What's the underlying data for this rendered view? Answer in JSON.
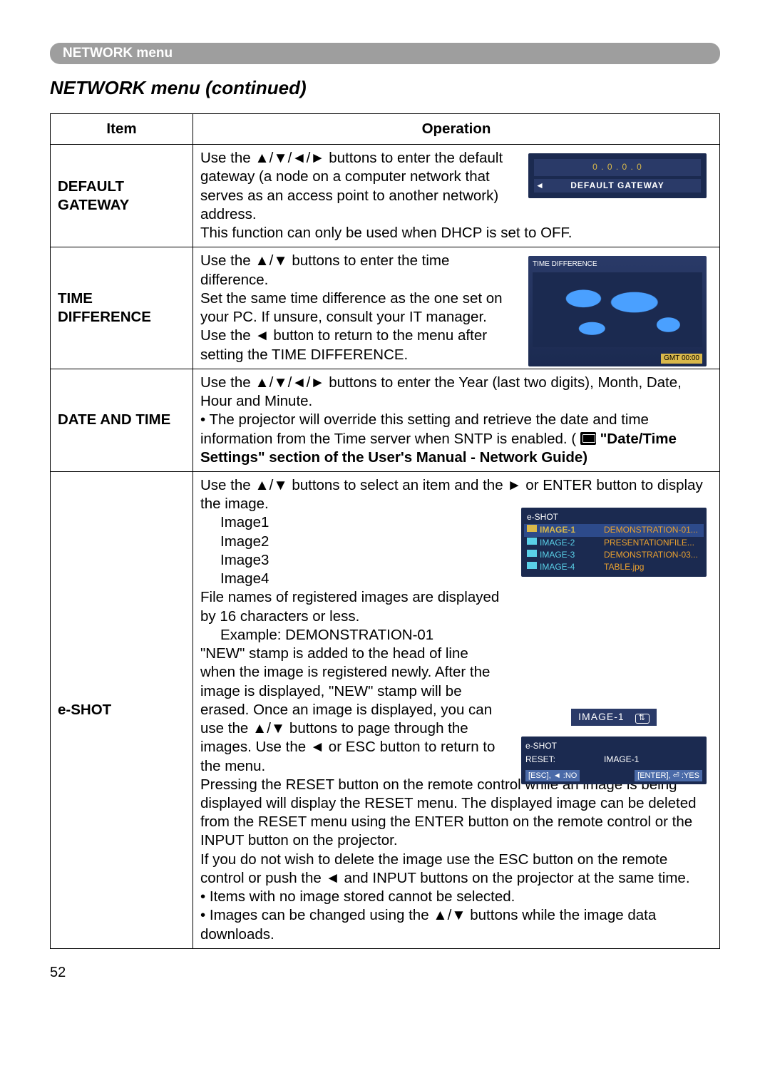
{
  "header": {
    "menu_label": "NETWORK menu"
  },
  "section_title": "NETWORK menu (continued)",
  "table": {
    "col_item": "Item",
    "col_operation": "Operation"
  },
  "rows": {
    "default_gateway": {
      "item": "DEFAULT GATEWAY",
      "op_line1": "Use the ▲/▼/◄/► buttons to enter the default gateway (a node on a computer network that serves as an access point to another network) address.",
      "op_line2": "This function can only be used when DHCP is set to OFF.",
      "thumb_field": "0  .  0  .  0  .  0",
      "thumb_label": "DEFAULT GATEWAY"
    },
    "time_diff": {
      "item": "TIME DIFFERENCE",
      "op": "Use the ▲/▼ buttons to enter the time difference.\nSet the same time difference as the one set on your PC. If unsure, consult your IT manager. Use the ◄ button to return to the menu after setting the TIME DIFFERENCE.",
      "thumb_title": "TIME DIFFERENCE",
      "thumb_gmt": "GMT 00:00"
    },
    "date_time": {
      "item": "DATE AND TIME",
      "op_line1": "Use the ▲/▼/◄/► buttons to enter the Year (last two digits), Month, Date, Hour and Minute.",
      "op_bullet1": "• The projector will override this setting and retrieve the date and time information from the Time server when SNTP is enabled. (",
      "op_bold": "\"Date/Time Settings\" section of the User's Manual - Network Guide)",
      "book_label": ""
    },
    "eshot": {
      "item": "e-SHOT",
      "op_top1": "Use the ▲/▼ buttons to select an item and the ► or ENTER button to display the image.",
      "img1": "Image1",
      "img2": "Image2",
      "img3": "Image3",
      "img4": "Image4",
      "op_mid1": "File names of registered images are displayed by 16 characters or less.",
      "op_example": "Example: DEMONSTRATION-01",
      "op_mid2": "\"NEW\" stamp is added to the head of line when the image is registered newly. After the image is displayed, \"NEW\" stamp will be erased. Once an image is displayed, you can use the ▲/▼ buttons to page through the images. Use the ◄ or ESC button to return to the menu.",
      "op_bot1": "Pressing the RESET button on the remote control while an image is being displayed will display the RESET menu. The displayed image can be deleted from the RESET menu using the ENTER button on the remote control or the INPUT button on the projector.",
      "op_bot2": "If you do not wish to delete the image use the ESC button on the remote control or push the ◄ and INPUT buttons on the projector at the same time.",
      "op_bullet2": "• Items with no image stored cannot be selected.",
      "op_bullet3": "• Images can be changed using the ▲/▼ buttons while the image data downloads.",
      "thumb1": {
        "title": "e-SHOT",
        "r1_l": "IMAGE-1",
        "r1_r": "DEMONSTRATION-01...",
        "r2_l": "IMAGE-2",
        "r2_r": "PRESENTATIONFILE...",
        "r3_l": "IMAGE-3",
        "r3_r": "DEMONSTRATION-03...",
        "r4_l": "IMAGE-4",
        "r4_r": "TABLE.jpg"
      },
      "thumb2": {
        "label": "IMAGE-1",
        "chip": "⇅"
      },
      "thumb3": {
        "title": "e-SHOT",
        "row_l": "RESET:",
        "row_r": "IMAGE-1",
        "foot_l": "[ESC], ◄ :NO",
        "foot_r": "[ENTER], ⏎ :YES"
      }
    }
  },
  "page_number": "52"
}
